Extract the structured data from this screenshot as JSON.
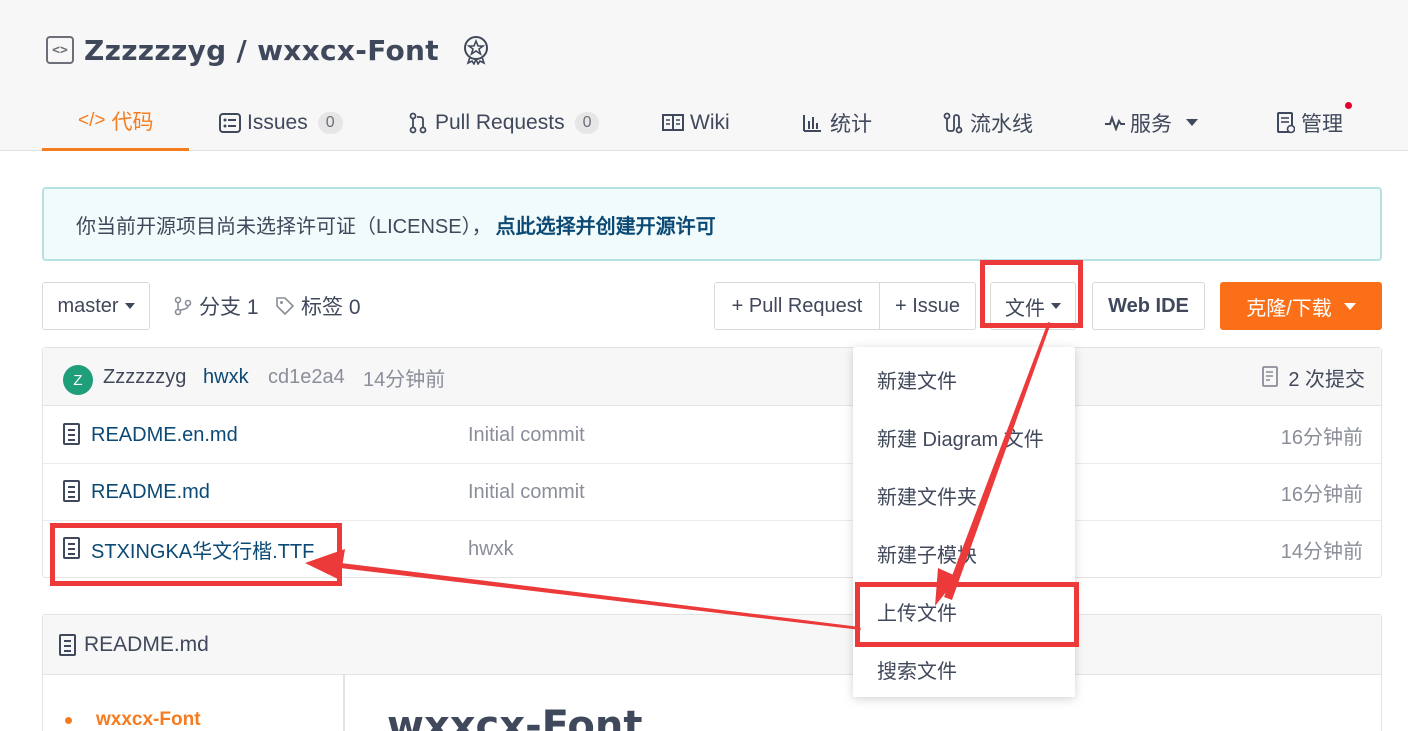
{
  "repo": {
    "owner": "Zzzzzzyg",
    "separator": "/",
    "name": "wxxcx-Font"
  },
  "tabs": [
    {
      "label": "代码",
      "icon": "code-icon"
    },
    {
      "label": "Issues",
      "count": "0",
      "icon": "issues-icon"
    },
    {
      "label": "Pull Requests",
      "count": "0",
      "icon": "pull-request-icon"
    },
    {
      "label": "Wiki",
      "icon": "book-icon"
    },
    {
      "label": "统计",
      "icon": "chart-icon"
    },
    {
      "label": "流水线",
      "icon": "pipeline-icon"
    },
    {
      "label": "服务",
      "icon": "pulse-icon"
    },
    {
      "label": "管理",
      "icon": "manage-icon"
    }
  ],
  "license": {
    "text": "你当前开源项目尚未选择许可证（LICENSE），",
    "link": "点此选择并创建开源许可"
  },
  "toolbar": {
    "branch": "master",
    "branches_label": "分支 1",
    "tags_label": "标签 0",
    "pull_request": "+ Pull Request",
    "issue": "+ Issue",
    "file": "文件",
    "web_ide": "Web IDE",
    "clone": "克隆/下载"
  },
  "commit": {
    "avatar_letter": "Z",
    "author": "Zzzzzzyg",
    "message": "hwxk",
    "hash": "cd1e2a4",
    "time": "14分钟前",
    "count_label": "2 次提交"
  },
  "files": [
    {
      "name": "README.en.md",
      "message": "Initial commit",
      "time": "16分钟前"
    },
    {
      "name": "README.md",
      "message": "Initial commit",
      "time": "16分钟前"
    },
    {
      "name": "STXINGKA华文行楷.TTF",
      "message": "hwxk",
      "time": "14分钟前"
    }
  ],
  "file_menu": [
    "新建文件",
    "新建 Diagram 文件",
    "新建文件夹",
    "新建子模块",
    "上传文件",
    "搜索文件"
  ],
  "readme": {
    "title": "README.md",
    "toc_item": "wxxcx-Font",
    "heading": "wxxcx-Font"
  },
  "annotation_color": "#ec3a3a",
  "accent_color": "#f57c1f"
}
